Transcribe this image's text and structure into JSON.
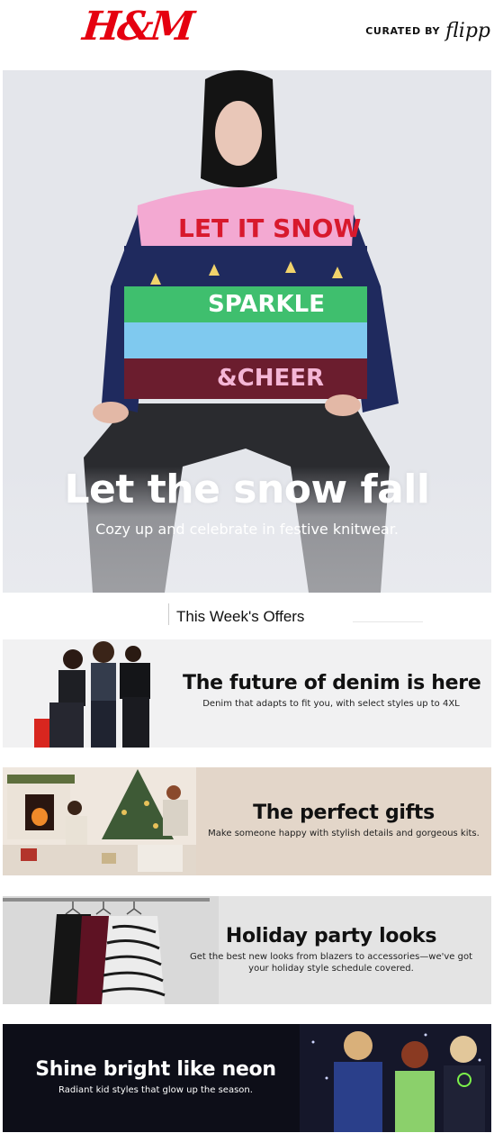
{
  "header": {
    "brand": "H&M",
    "curated_label": "CURATED BY",
    "curator_logo": "flipp"
  },
  "hero": {
    "title": "Let the snow fall",
    "subtitle": "Cozy up and celebrate in festive knitwear."
  },
  "section": {
    "title": "This Week's Offers"
  },
  "offers": [
    {
      "title": "The future of denim is here",
      "description": "Denim that adapts to fit you, with select styles up to 4XL"
    },
    {
      "title": "The perfect gifts",
      "description": "Make someone happy with stylish details and gorgeous kits."
    },
    {
      "title": "Holiday party looks",
      "description": "Get the best new looks from blazers to accessories—we've got your holiday style schedule covered."
    },
    {
      "title": "Shine bright like neon",
      "description": "Radiant kid styles that glow up the season."
    }
  ],
  "colors": {
    "brand_red": "#e50010",
    "hero_bg": "#e4e6eb",
    "gifts_bg": "#e3d6c9",
    "neon_bg": "#0d0e18"
  }
}
